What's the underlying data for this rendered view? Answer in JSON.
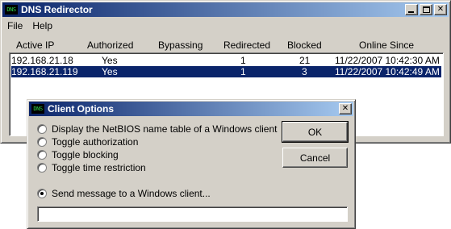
{
  "main_window": {
    "icon_text": "DNS",
    "title": "DNS Redirector",
    "menu": [
      "File",
      "Help"
    ],
    "columns": [
      "Active IP",
      "Authorized",
      "Bypassing",
      "Redirected",
      "Blocked",
      "Online Since"
    ],
    "rows": [
      {
        "ip": "192.168.21.18",
        "authorized": "Yes",
        "bypassing": "",
        "redirected": "1",
        "blocked": "21",
        "online_since": "11/22/2007 10:42:30 AM",
        "selected": false
      },
      {
        "ip": "192.168.21.119",
        "authorized": "Yes",
        "bypassing": "",
        "redirected": "1",
        "blocked": "3",
        "online_since": "11/22/2007 10:42:49 AM",
        "selected": true
      }
    ]
  },
  "dialog": {
    "icon_text": "DNS",
    "title": "Client Options",
    "options": [
      {
        "label": "Display the NetBIOS name table of a Windows client",
        "checked": false
      },
      {
        "label": "Toggle authorization",
        "checked": false
      },
      {
        "label": "Toggle blocking",
        "checked": false
      },
      {
        "label": "Toggle time restriction",
        "checked": false
      },
      {
        "label": "Send message to a Windows client...",
        "checked": true
      }
    ],
    "ok_label": "OK",
    "cancel_label": "Cancel",
    "message_value": ""
  },
  "colors": {
    "titlebar_start": "#0a246a",
    "titlebar_end": "#a6caf0",
    "selection": "#0a246a",
    "face": "#d4d0c8"
  }
}
